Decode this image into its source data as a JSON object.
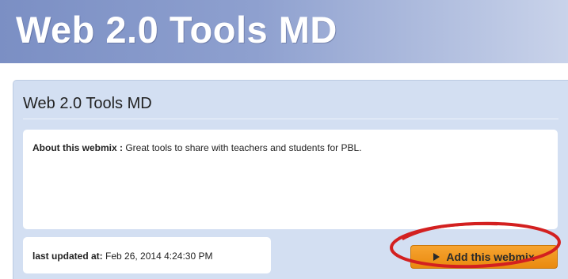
{
  "banner": {
    "title": "Web 2.0 Tools MD"
  },
  "panel": {
    "title": "Web 2.0 Tools MD",
    "about": {
      "label": "About this webmix :",
      "text": "Great tools to share with teachers and students for PBL."
    },
    "updated": {
      "label": "last updated at:",
      "value": "Feb 26, 2014 4:24:30 PM"
    },
    "add_button": {
      "label": "Add this webmix",
      "icon": "play-icon"
    }
  },
  "colors": {
    "banner": "#8ea0cf",
    "panel_bg": "#d3dff2",
    "button": "#f29a1e",
    "annotation": "#d32020"
  }
}
